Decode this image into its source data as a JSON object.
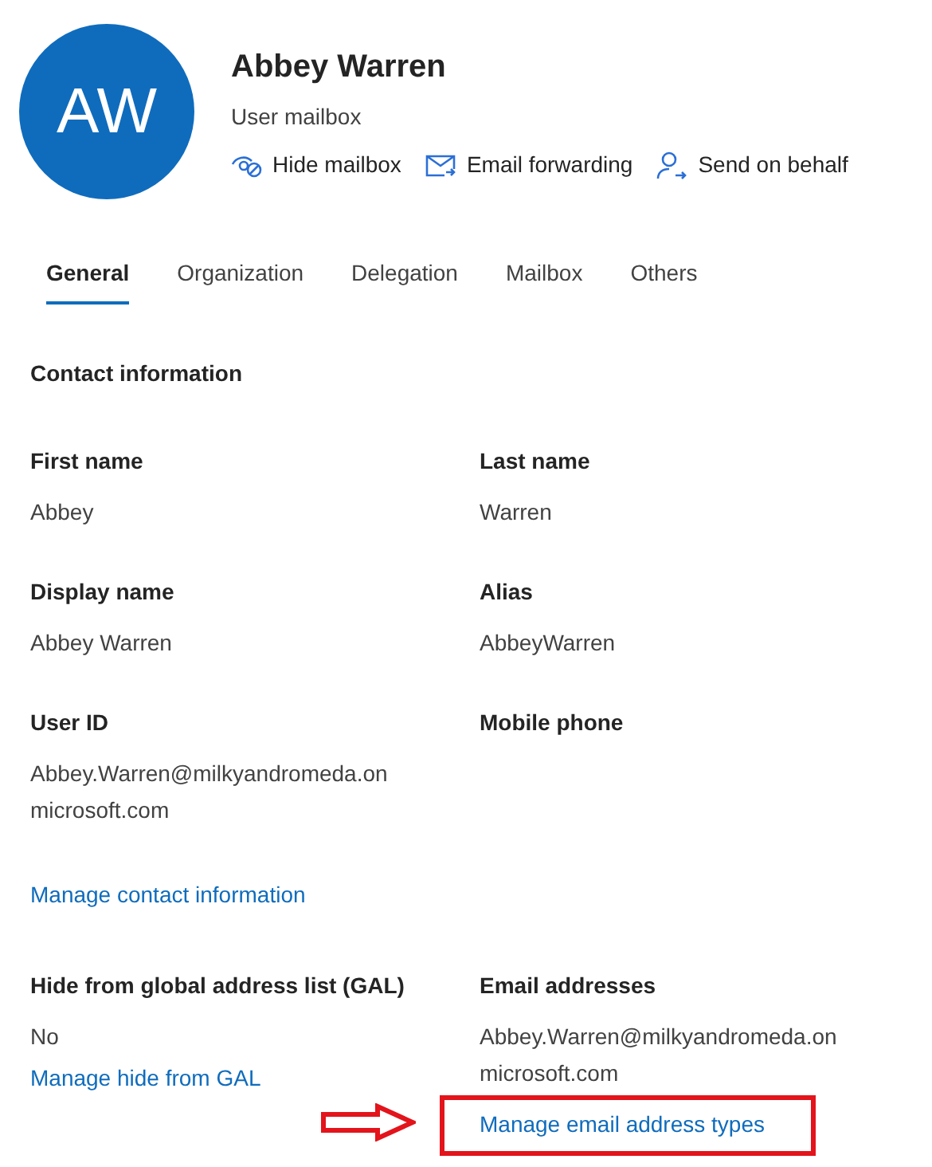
{
  "profile": {
    "initials": "AW",
    "name": "Abbey Warren",
    "subtitle": "User mailbox"
  },
  "actions": [
    {
      "kind": "hide",
      "label": "Hide mailbox"
    },
    {
      "kind": "forward",
      "label": "Email forwarding"
    },
    {
      "kind": "behalf",
      "label": "Send on behalf"
    }
  ],
  "tabs": [
    {
      "label": "General",
      "selected": true
    },
    {
      "label": "Organization",
      "selected": false
    },
    {
      "label": "Delegation",
      "selected": false
    },
    {
      "label": "Mailbox",
      "selected": false
    },
    {
      "label": "Others",
      "selected": false
    }
  ],
  "section_title": "Contact information",
  "groups": [
    {
      "rows": [
        [
          {
            "label": "First name",
            "value": "Abbey"
          },
          {
            "label": "Last name",
            "value": "Warren"
          }
        ],
        [
          {
            "label": "Display name",
            "value": "Abbey Warren"
          },
          {
            "label": "Alias",
            "value": "AbbeyWarren"
          }
        ],
        [
          {
            "label": "User ID",
            "value": "Abbey.Warren@milkyandromeda.onmicrosoft.com"
          },
          {
            "label": "Mobile phone"
          }
        ]
      ],
      "link": {
        "label": "Manage contact information",
        "highlighted": false
      }
    },
    {
      "rows": [
        [
          {
            "label": "Hide from global address list (GAL)",
            "value": "No",
            "link": {
              "label": "Manage hide from GAL",
              "highlighted": false
            }
          },
          {
            "label": "Email addresses",
            "value": "Abbey.Warren@milkyandromeda.onmicrosoft.com",
            "link": {
              "label": "Manage email address types",
              "highlighted": true
            }
          }
        ]
      ]
    }
  ]
}
